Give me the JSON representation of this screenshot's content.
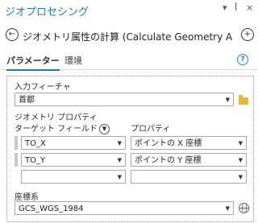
{
  "pane": {
    "title": "ジオプロセシング",
    "controls": {
      "menu": "▾",
      "pin": "ꟾ",
      "close": "×"
    }
  },
  "tool": {
    "title": "ジオメトリ属性の計算 (Calculate Geometry A",
    "back_glyph": "←",
    "add_glyph": "+"
  },
  "tabs": [
    {
      "label": "パラメーター",
      "active": true
    },
    {
      "label": "環境",
      "active": false
    }
  ],
  "help_glyph": "?",
  "params": {
    "input_features_label": "入力フィーチャ",
    "input_features_value": "首都",
    "geometry_properties_label": "ジオメトリ プロパティ",
    "target_field_label": "ターゲット フィールド",
    "property_label": "プロパティ",
    "rows": [
      {
        "field": "TO_X",
        "property": "ポイントの X 座標"
      },
      {
        "field": "TO_Y",
        "property": "ポイントの Y 座標"
      },
      {
        "field": "",
        "property": ""
      }
    ],
    "crs_label": "座標系",
    "crs_value": "GCS_WGS_1984"
  }
}
